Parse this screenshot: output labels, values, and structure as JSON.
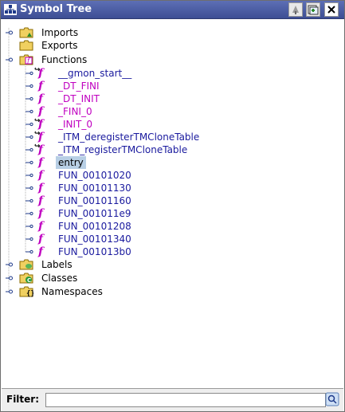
{
  "window": {
    "title": "Symbol Tree"
  },
  "tree": {
    "imports": "Imports",
    "exports": "Exports",
    "functions": "Functions",
    "functions_items": [
      {
        "name": "__gmon_start__",
        "thunk": true,
        "external": false
      },
      {
        "name": "_DT_FINI",
        "thunk": false,
        "external": true
      },
      {
        "name": "_DT_INIT",
        "thunk": false,
        "external": true
      },
      {
        "name": "_FINI_0",
        "thunk": false,
        "external": true
      },
      {
        "name": "_INIT_0",
        "thunk": true,
        "external": true
      },
      {
        "name": "_ITM_deregisterTMCloneTable",
        "thunk": true,
        "external": false
      },
      {
        "name": "_ITM_registerTMCloneTable",
        "thunk": true,
        "external": false
      },
      {
        "name": "entry",
        "thunk": false,
        "external": false,
        "selected": true
      },
      {
        "name": "FUN_00101020",
        "thunk": false,
        "external": false
      },
      {
        "name": "FUN_00101130",
        "thunk": false,
        "external": false
      },
      {
        "name": "FUN_00101160",
        "thunk": false,
        "external": false
      },
      {
        "name": "FUN_001011e9",
        "thunk": false,
        "external": false
      },
      {
        "name": "FUN_00101208",
        "thunk": false,
        "external": false
      },
      {
        "name": "FUN_00101340",
        "thunk": false,
        "external": false
      },
      {
        "name": "FUN_001013b0",
        "thunk": false,
        "external": false
      }
    ],
    "labels": "Labels",
    "classes": "Classes",
    "namespaces": "Namespaces",
    "function_icon_glyph": "f"
  },
  "filter": {
    "label": "Filter:",
    "value": ""
  },
  "colors": {
    "titlebar": "#3d4e94",
    "function_icon": "#c000c0",
    "function_label": "#1a1a9e",
    "selection": "#b8cfe5"
  }
}
